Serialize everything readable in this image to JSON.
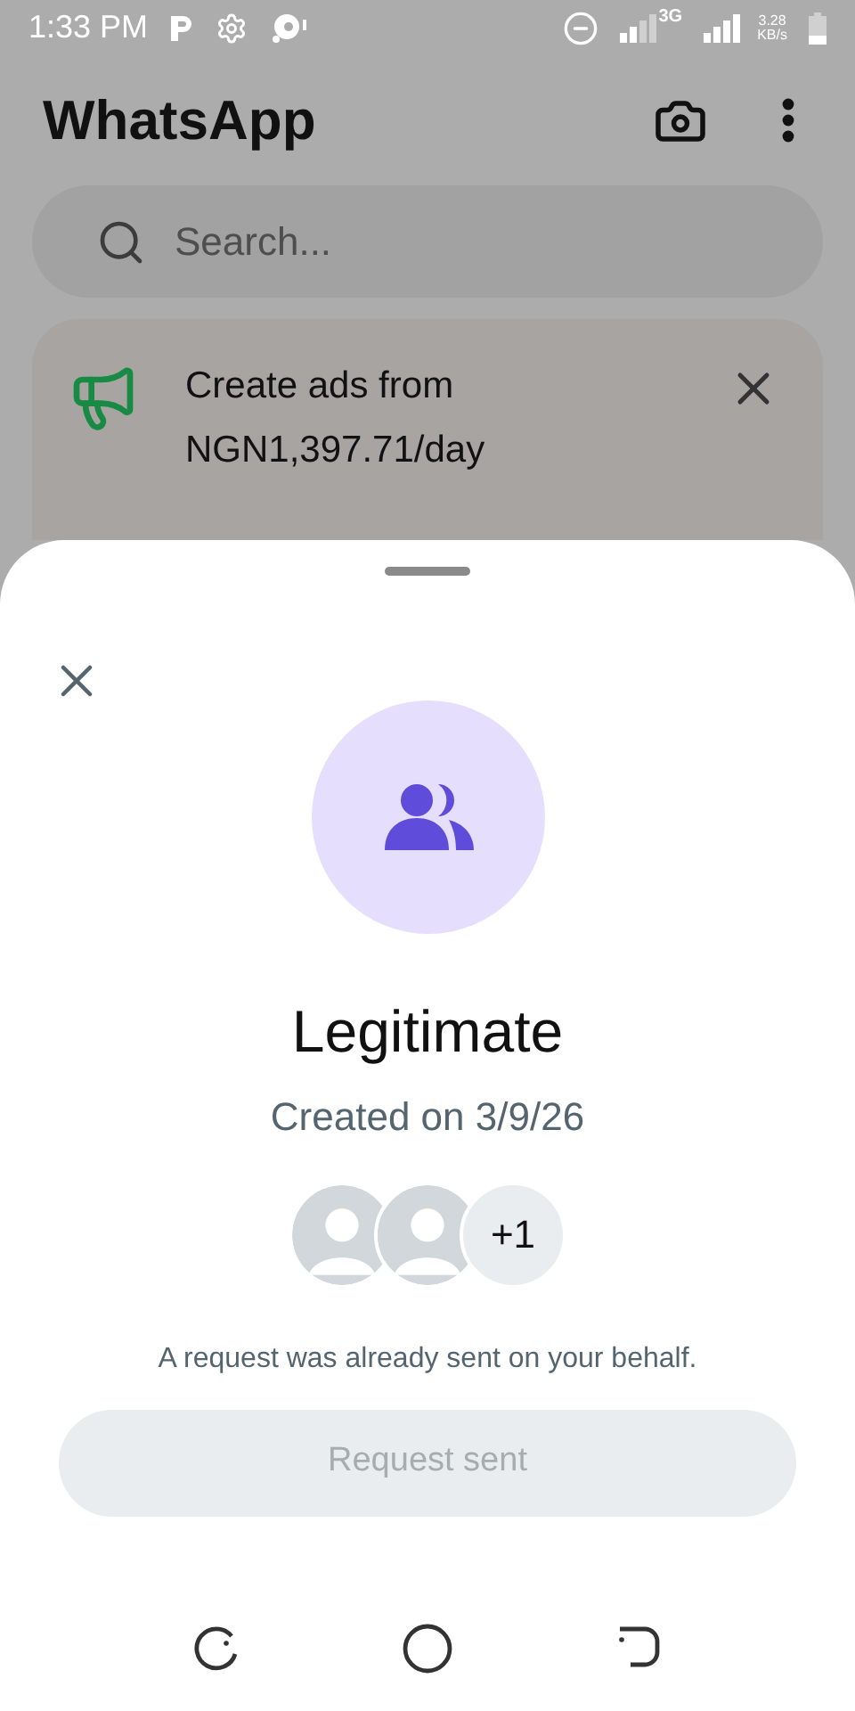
{
  "status_bar": {
    "time": "1:33 PM",
    "network": "3G",
    "speed": "3.28",
    "speed_unit": "KB/s"
  },
  "app_bar": {
    "title": "WhatsApp"
  },
  "search": {
    "placeholder": "Search..."
  },
  "ad_banner": {
    "text": "Create ads from NGN1,397.71/day"
  },
  "sheet": {
    "title": "Legitimate",
    "subtitle": "Created on 3/9/26",
    "more_members": "+1",
    "note": "A request was already sent on your behalf.",
    "button": {
      "label": "Request sent",
      "disabled": true
    }
  }
}
